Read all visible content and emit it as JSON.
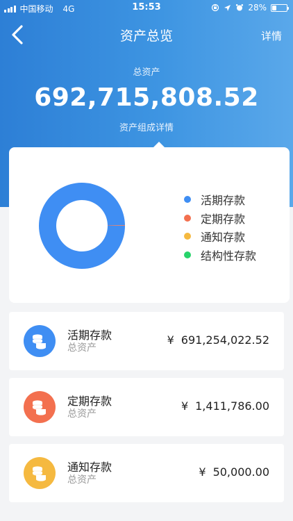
{
  "status_bar": {
    "carrier": "中国移动",
    "network": "4G",
    "time": "15:53",
    "battery": "28%",
    "battery_level": 0.28
  },
  "nav": {
    "title": "资产总览",
    "detail_label": "详情"
  },
  "summary": {
    "total_label": "总资产",
    "total_amount": "692,715,808.52",
    "composition_link": "资产组成详情"
  },
  "chart_data": {
    "type": "pie",
    "donut": true,
    "categories": [
      "活期存款",
      "定期存款",
      "通知存款",
      "结构性存款"
    ],
    "values": [
      691254022.52,
      1411786.0,
      50000.0,
      0
    ],
    "colors": [
      "#3f8ef3",
      "#f3704f",
      "#f5b940",
      "#28d36b"
    ],
    "legend": "right"
  },
  "assets": [
    {
      "name": "活期存款",
      "sub": "总资产",
      "currency": "¥",
      "amount": "691,254,022.52",
      "color": "#3f8ef3"
    },
    {
      "name": "定期存款",
      "sub": "总资产",
      "currency": "¥",
      "amount": "1,411,786.00",
      "color": "#f3704f"
    },
    {
      "name": "通知存款",
      "sub": "总资产",
      "currency": "¥",
      "amount": "50,000.00",
      "color": "#f5b940"
    }
  ],
  "colors": {
    "header_start": "#2d7fd6",
    "header_end": "#5aa8ea",
    "background": "#f3f4f6"
  }
}
